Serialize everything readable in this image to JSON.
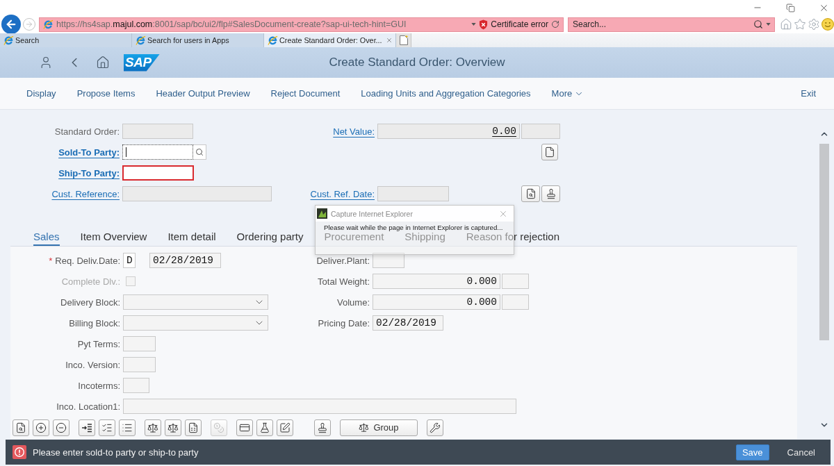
{
  "browser": {
    "address": {
      "url_start": "https://hs4sap.",
      "url_domain": "majul.com",
      "url_end": ":8001/sap/bc/ui2/flp#SalesDocument-create?sap-ui-tech-hint=GUI",
      "certificate": "Certificate error"
    },
    "search": {
      "placeholder": "Search..."
    },
    "tabs": [
      {
        "label": "Search",
        "selected": false
      },
      {
        "label": "Search for users in Apps",
        "selected": false
      },
      {
        "label": "Create Standard Order: Over...",
        "selected": true
      }
    ]
  },
  "shell": {
    "logo": "SAP",
    "title": "Create Standard Order: Overview"
  },
  "toolbar": {
    "items": [
      {
        "label": "Display",
        "kind": "action"
      },
      {
        "label": "Propose Items",
        "kind": "action"
      },
      {
        "label": "Header Output Preview",
        "kind": "action"
      },
      {
        "label": "Reject Document",
        "kind": "action"
      },
      {
        "label": "Loading Units and Aggregation Categories",
        "kind": "action"
      },
      {
        "label": "More",
        "kind": "menu"
      }
    ],
    "exit": "Exit"
  },
  "header_form": [
    {
      "left": {
        "label": "Standard Order:",
        "link": false,
        "required": false,
        "kind": "text",
        "readonly": true,
        "focused": false,
        "error": false
      },
      "right": {
        "label": "Net Value:",
        "link": true,
        "required": false,
        "kind": "amount",
        "value": "0.00",
        "readonly": true,
        "focused": false,
        "error": false
      }
    },
    {
      "left": {
        "label": "Sold-To Party:",
        "link": true,
        "required": true,
        "kind": "search",
        "readonly": false,
        "focused": true,
        "error": false
      }
    },
    {
      "left": {
        "label": "Ship-To Party:",
        "link": true,
        "required": true,
        "kind": "text",
        "readonly": false,
        "focused": false,
        "error": true
      }
    },
    {
      "left": {
        "label": "Cust. Reference:",
        "link": true,
        "required": false,
        "kind": "text",
        "readonly": true,
        "focused": false,
        "error": false
      },
      "right": {
        "label": "Cust. Ref. Date:",
        "link": true,
        "required": false,
        "kind": "text",
        "readonly": true,
        "focused": false,
        "error": false
      }
    }
  ],
  "detail_tabs": [
    {
      "label": "Sales",
      "selected": true
    },
    {
      "label": "Item Overview",
      "selected": false
    },
    {
      "label": "Item detail",
      "selected": false
    },
    {
      "label": "Ordering party",
      "selected": false
    },
    {
      "label": "Procurement",
      "selected": false
    },
    {
      "label": "Shipping",
      "selected": false
    },
    {
      "label": "Reason for rejection",
      "selected": false
    }
  ],
  "sales_fields": [
    {
      "left": {
        "marker": "*",
        "label": "Req. Deliv.Date:",
        "disabled": false,
        "kind": "date",
        "code": "D",
        "value": "02/28/2019"
      },
      "right": {
        "label": "Deliver.Plant:",
        "kind": "text"
      }
    },
    {
      "left": {
        "label": "Complete Dlv.:",
        "disabled": true,
        "kind": "checkbox",
        "checked": false
      },
      "right": {
        "label": "Total Weight:",
        "kind": "quantity",
        "value": "0.000"
      }
    },
    {
      "left": {
        "label": "Delivery Block:",
        "disabled": false,
        "kind": "dropdown"
      },
      "right": {
        "label": "Volume:",
        "kind": "quantity",
        "value": "0.000"
      }
    },
    {
      "left": {
        "label": "Billing Block:",
        "disabled": false,
        "kind": "dropdown"
      },
      "right": {
        "label": "Pricing Date:",
        "kind": "text",
        "value": "02/28/2019"
      }
    },
    {
      "left": {
        "label": "Pyt Terms:",
        "disabled": false,
        "kind": "text"
      }
    },
    {
      "left": {
        "label": "Inco. Version:",
        "disabled": false,
        "kind": "text"
      }
    },
    {
      "left": {
        "label": "Incoterms:",
        "disabled": false,
        "kind": "text"
      }
    },
    {
      "left": {
        "label": "Inco. Location1:",
        "disabled": false,
        "kind": "text"
      }
    }
  ],
  "item_toolbar": {
    "groups": [
      {
        "buttons": [
          {
            "kind": "icon",
            "disabled": false
          },
          {
            "kind": "icon",
            "disabled": false
          },
          {
            "kind": "icon",
            "disabled": false
          }
        ]
      },
      {
        "buttons": [
          {
            "kind": "icon",
            "disabled": false
          },
          {
            "kind": "icon",
            "disabled": false
          },
          {
            "kind": "icon",
            "disabled": false
          }
        ]
      },
      {
        "buttons": [
          {
            "kind": "icon",
            "disabled": false
          },
          {
            "kind": "icon",
            "disabled": false
          },
          {
            "kind": "icon",
            "disabled": false
          }
        ]
      },
      {
        "buttons": [
          {
            "kind": "icon",
            "disabled": true
          }
        ]
      },
      {
        "buttons": [
          {
            "kind": "icon",
            "disabled": false
          },
          {
            "kind": "icon",
            "disabled": false
          },
          {
            "kind": "icon",
            "disabled": false
          }
        ]
      },
      {
        "buttons": [
          {
            "kind": "icon",
            "disabled": false
          }
        ]
      },
      {
        "buttons": [
          {
            "kind": "labeled",
            "label": "Group",
            "disabled": false
          }
        ]
      },
      {
        "buttons": [
          {
            "kind": "icon",
            "disabled": false
          }
        ]
      }
    ]
  },
  "dialog": {
    "title": "Capture Internet Explorer",
    "message": "Please wait while the page in Internet Explorer is captured..."
  },
  "message_bar": {
    "kind": "error",
    "message": "Please enter sold-to party or ship-to party",
    "buttons": [
      {
        "label": "Save",
        "kind": "primary"
      },
      {
        "label": "Cancel",
        "kind": "plain"
      }
    ]
  }
}
